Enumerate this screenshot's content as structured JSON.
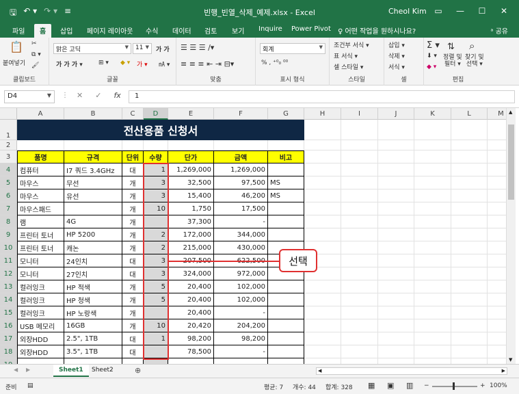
{
  "titlebar": {
    "filename": "빈행_빈열_삭제_예제.xlsx  -  Excel",
    "user": "Cheol Kim",
    "qat_save": "🖫",
    "qat_undo": "↶ ▾",
    "qat_redo": "↷ ▾",
    "qat_more": "≡",
    "win_restore": "▭",
    "win_min": "—",
    "win_max": "☐",
    "win_close": "✕"
  },
  "ribbon_tabs": [
    "파일",
    "홈",
    "삽입",
    "페이지 레이아웃",
    "수식",
    "데이터",
    "검토",
    "보기",
    "Inquire",
    "Power Pivot",
    "♀ 어떤 작업을 원하시나요?"
  ],
  "active_tab": "홈",
  "share_label": "ᵃ 공유",
  "ribbon": {
    "clipboard": {
      "paste": "붙여넣기",
      "label": "클립보드"
    },
    "font": {
      "name": "맑은 고딕",
      "size": "11",
      "grow": "가 가",
      "bold_row": "가  가  가  ▾",
      "label": "글꼴"
    },
    "align": {
      "label": "맞춤"
    },
    "number": {
      "format": "회계",
      "symbols": "% ,  ⁺⁰₀ ⁰⁰",
      "label": "표시 형식"
    },
    "styles": {
      "cond": "조건부 서식 ▾",
      "table": "표 서식 ▾",
      "cell": "셀 스타일 ▾",
      "label": "스타일"
    },
    "cells": {
      "insert": "삽입 ▾",
      "delete": "삭제 ▾",
      "format": "서식 ▾",
      "label": "셀"
    },
    "edit": {
      "sort": "정렬 및\n필터 ▾",
      "find": "찾기 및\n선택 ▾",
      "label": "편집"
    }
  },
  "formula_bar": {
    "namebox": "D4",
    "formula": "1",
    "cancel": "✕",
    "enter": "✓",
    "fx": "fx"
  },
  "columns": [
    "A",
    "B",
    "C",
    "D",
    "E",
    "F",
    "G",
    "H",
    "I",
    "J",
    "K",
    "L",
    "M"
  ],
  "rows": [
    "1",
    "2",
    "3",
    "4",
    "5",
    "6",
    "7",
    "8",
    "9",
    "10",
    "11",
    "12",
    "13",
    "14",
    "15",
    "16",
    "17",
    "18",
    "19"
  ],
  "sheet": {
    "title": "전산용품 신청서",
    "headers": [
      "품명",
      "규격",
      "단위",
      "수량",
      "단가",
      "금액",
      "비고"
    ],
    "data": [
      [
        "컴퓨터",
        "I7 쿼드 3.4GHz",
        "대",
        "1",
        "1,269,000",
        "1,269,000",
        ""
      ],
      [
        "마우스",
        "무선",
        "개",
        "3",
        "32,500",
        "97,500",
        "MS"
      ],
      [
        "마우스",
        "유선",
        "개",
        "3",
        "15,400",
        "46,200",
        "MS"
      ],
      [
        "마우스패드",
        "",
        "개",
        "10",
        "1,750",
        "17,500",
        ""
      ],
      [
        "램",
        "4G",
        "개",
        "",
        "37,300",
        "-",
        ""
      ],
      [
        "프린터 토너",
        "HP 5200",
        "개",
        "2",
        "172,000",
        "344,000",
        ""
      ],
      [
        "프린터 토너",
        "캐논",
        "개",
        "2",
        "215,000",
        "430,000",
        ""
      ],
      [
        "모니터",
        "24인치",
        "대",
        "3",
        "207,500",
        "622,500",
        ""
      ],
      [
        "모니터",
        "27인치",
        "대",
        "3",
        "324,000",
        "972,000",
        ""
      ],
      [
        "컬러잉크",
        "HP 적색",
        "개",
        "5",
        "20,400",
        "102,000",
        ""
      ],
      [
        "컬러잉크",
        "HP 청색",
        "개",
        "5",
        "20,400",
        "102,000",
        ""
      ],
      [
        "컬러잉크",
        "HP 노랑색",
        "개",
        "",
        "20,400",
        "-",
        ""
      ],
      [
        "USB 메모리",
        "16GB",
        "개",
        "10",
        "20,420",
        "204,200",
        ""
      ],
      [
        "외장HDD",
        "2.5\", 1TB",
        "대",
        "1",
        "98,200",
        "98,200",
        ""
      ],
      [
        "외장HDD",
        "3.5\", 1TB",
        "대",
        "",
        "78,500",
        "-",
        ""
      ]
    ]
  },
  "callout": "선택",
  "sheet_tabs": [
    "Sheet1",
    "Sheet2"
  ],
  "add_sheet": "⊕",
  "status": {
    "ready": "준비",
    "average": "평균: 7",
    "count": "개수: 44",
    "sum": "합계: 328",
    "zoom": "100%",
    "zoom_minus": "−",
    "zoom_plus": "+"
  }
}
